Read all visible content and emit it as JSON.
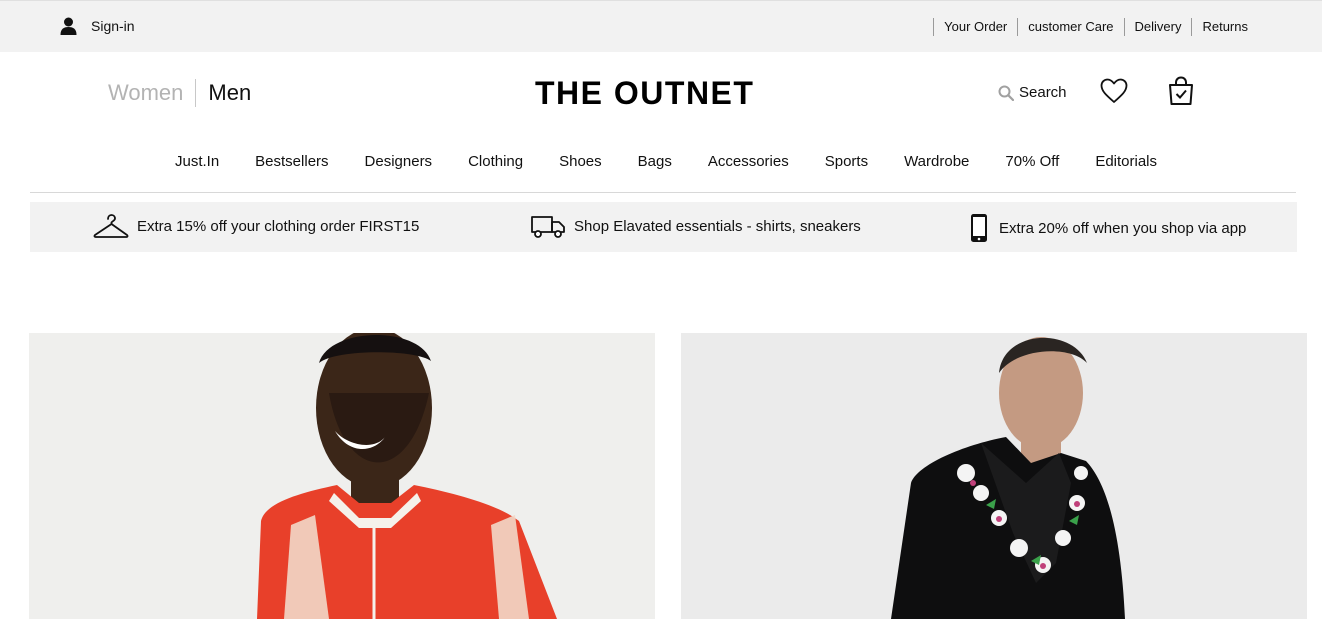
{
  "topbar": {
    "signin_label": "Sign-in",
    "links": [
      "Your Order",
      "customer Care",
      "Delivery",
      "Returns"
    ]
  },
  "header": {
    "gender_women": "Women",
    "gender_men": "Men",
    "logo": "THE OUTNET",
    "search_label": "Search"
  },
  "nav": {
    "items": [
      "Just.In",
      "Bestsellers",
      "Designers",
      "Clothing",
      "Shoes",
      "Bags",
      "Accessories",
      "Sports",
      "Wardrobe",
      "70% Off",
      "Editorials"
    ]
  },
  "promos": [
    {
      "icon": "hanger-icon",
      "text": "Extra 15% off your clothing order FIRST15"
    },
    {
      "icon": "delivery-truck-icon",
      "text": "Shop Elavated essentials - shirts, sneakers"
    },
    {
      "icon": "smartphone-icon",
      "text": "Extra 20% off when you shop via app"
    }
  ],
  "colors": {
    "topbar_bg": "#f2f2f2",
    "promo_bg": "#f2f2f2",
    "text": "#111111",
    "muted_gender": "#b3b3b3"
  }
}
